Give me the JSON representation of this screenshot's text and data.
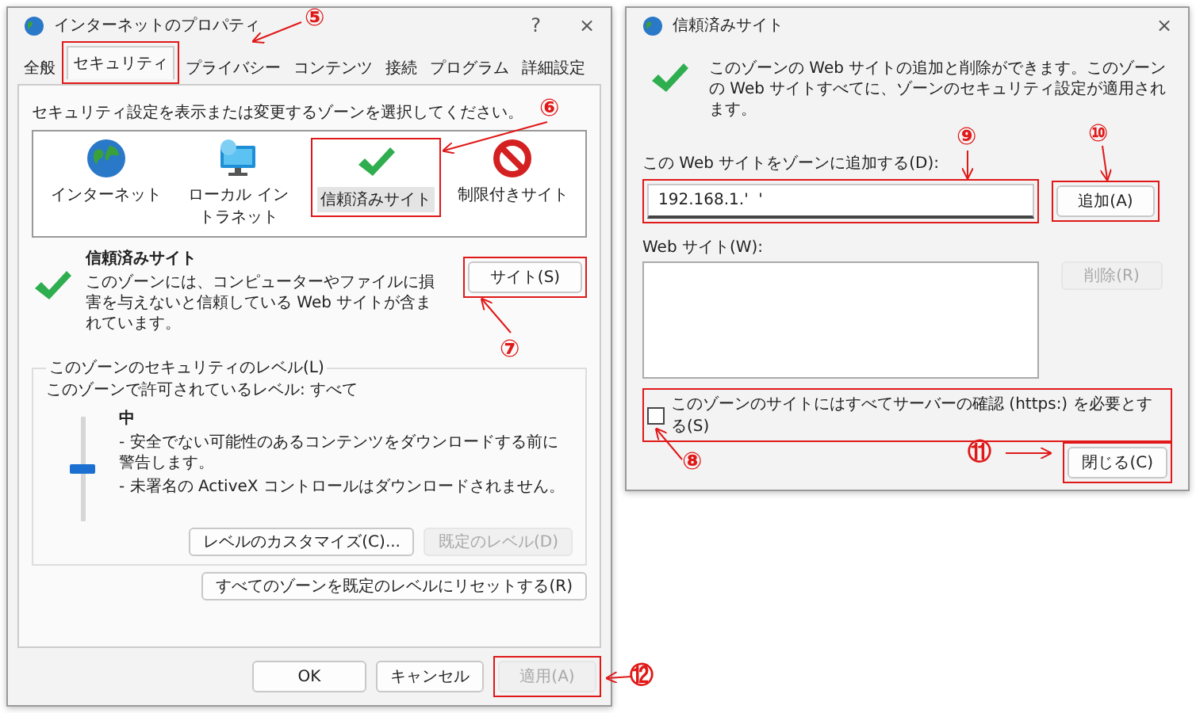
{
  "properties_dialog": {
    "title": "インターネットのプロパティ",
    "help_glyph": "?",
    "close_glyph": "×",
    "tabs": [
      {
        "label": "全般",
        "selected": false
      },
      {
        "label": "セキュリティ",
        "selected": true
      },
      {
        "label": "プライバシー",
        "selected": false
      },
      {
        "label": "コンテンツ",
        "selected": false
      },
      {
        "label": "接続",
        "selected": false
      },
      {
        "label": "プログラム",
        "selected": false
      },
      {
        "label": "詳細設定",
        "selected": false
      }
    ],
    "instruction": "セキュリティ設定を表示または変更するゾーンを選択してください。",
    "zones": [
      {
        "label": "インターネット",
        "kind": "globe",
        "selected": false
      },
      {
        "label": "ローカル イントラネット",
        "kind": "computer",
        "selected": false
      },
      {
        "label": "信頼済みサイト",
        "kind": "check",
        "selected": true
      },
      {
        "label": "制限付きサイト",
        "kind": "blocked",
        "selected": false
      }
    ],
    "zone_info": {
      "title": "信頼済みサイト",
      "description": "このゾーンには、コンピューターやファイルに損害を与えないと信頼している Web サイトが含まれています。"
    },
    "sites_button": "サイト(S)",
    "security_level": {
      "group_title": "このゾーンのセキュリティのレベル(L)",
      "allowed_levels": "このゾーンで許可されているレベル: すべて",
      "slider": {
        "level": 0.5
      },
      "level_name": "中",
      "bullets": [
        "- 安全でない可能性のあるコンテンツをダウンロードする前に警告します。",
        "- 未署名の ActiveX コントロールはダウンロードされません。"
      ],
      "buttons": [
        {
          "label": "レベルのカスタマイズ(C)...",
          "disabled": false
        },
        {
          "label": "既定のレベル(D)",
          "disabled": true
        }
      ]
    },
    "reset_button": "すべてのゾーンを既定のレベルにリセットする(R)",
    "footer_buttons": [
      {
        "label": "OK",
        "disabled": false
      },
      {
        "label": "キャンセル",
        "disabled": false
      },
      {
        "label": "適用(A)",
        "disabled": true
      }
    ]
  },
  "trusted_sites_dialog": {
    "title": "信頼済みサイト",
    "close_glyph": "×",
    "description": "このゾーンの Web サイトの追加と削除ができます。このゾーンの Web サイトすべてに、ゾーンのセキュリティ設定が適用されます。",
    "add_label": "この Web サイトをゾーンに追加する(D):",
    "add_field": {
      "value": "192.168.1.'  '"
    },
    "add_button": "追加(A)",
    "websites_label": "Web サイト(W):",
    "remove_button": {
      "label": "削除(R)",
      "disabled": true
    },
    "https_checkbox": {
      "label": "このゾーンのサイトにはすべてサーバーの確認 (https:) を必要とする(S)",
      "checked": false
    },
    "close_button": "閉じる(C)"
  },
  "annotations": [
    {
      "label": "⑤"
    },
    {
      "label": "⑥"
    },
    {
      "label": "⑦"
    },
    {
      "label": "⑧"
    },
    {
      "label": "⑨"
    },
    {
      "label": "⑩"
    },
    {
      "label": "⑪"
    },
    {
      "label": "⑫"
    }
  ]
}
